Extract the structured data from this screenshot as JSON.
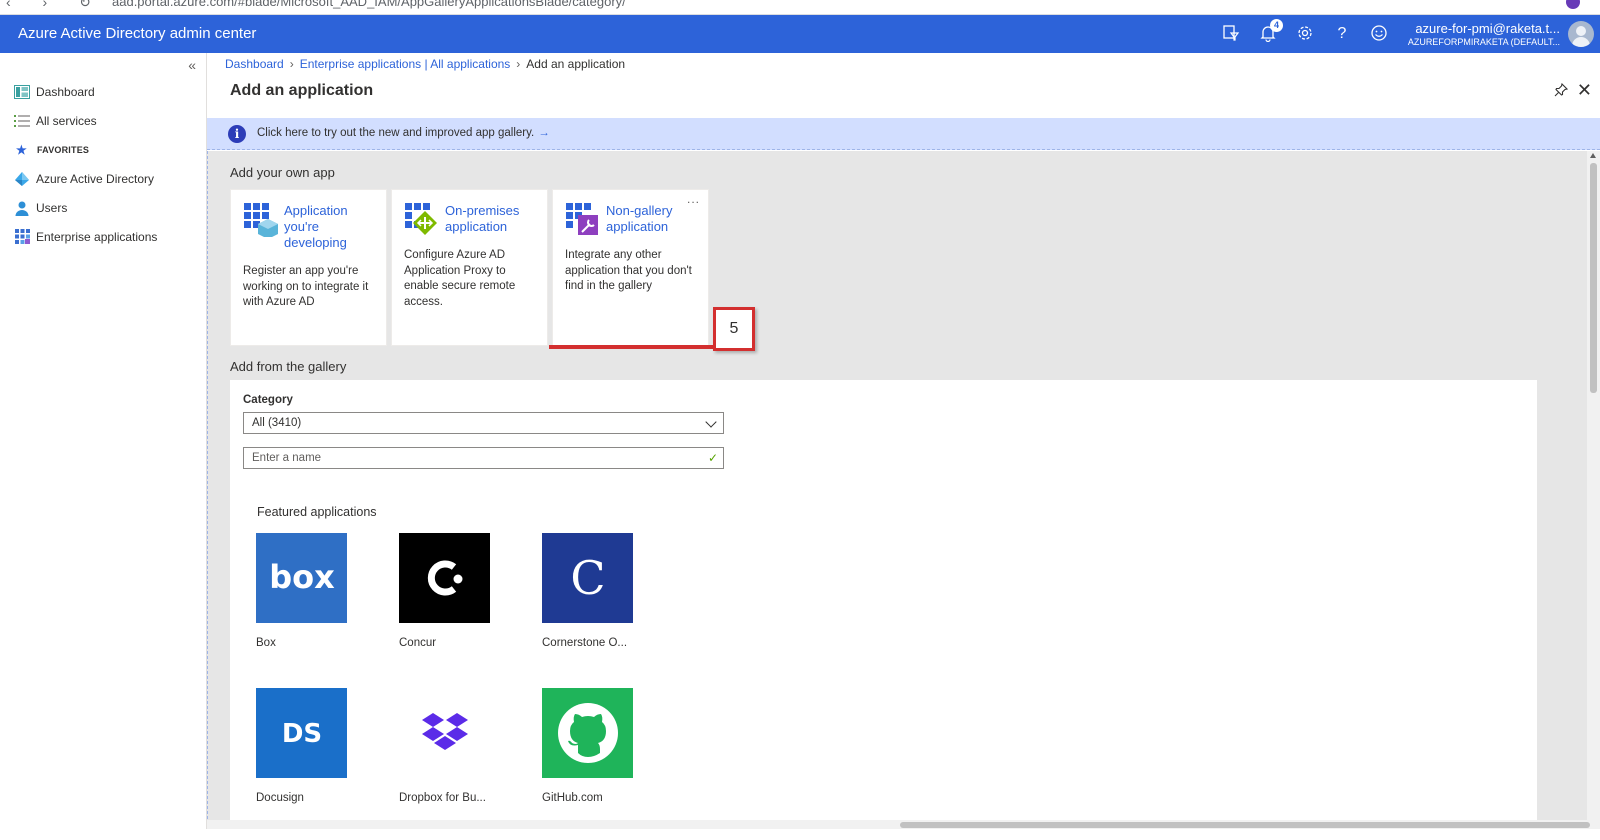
{
  "browser": {
    "url": "aad.portal.azure.com/#blade/Microsoft_AAD_IAM/AppGalleryApplicationsBlade/category/"
  },
  "topbar": {
    "title": "Azure Active Directory admin center",
    "notification_count": "4",
    "account_email": "azure-for-pmi@raketa.t...",
    "account_tenant": "AZUREFORPMIRAKETA (DEFAULT..."
  },
  "sidebar": {
    "collapse_icon": "«",
    "items": [
      {
        "label": "Dashboard",
        "icon": "dashboard-icon"
      },
      {
        "label": "All services",
        "icon": "list-icon"
      }
    ],
    "favorites_label": "FAVORITES",
    "favorites": [
      {
        "label": "Azure Active Directory",
        "icon": "aad-icon"
      },
      {
        "label": "Users",
        "icon": "user-icon"
      },
      {
        "label": "Enterprise applications",
        "icon": "apps-grid-icon"
      }
    ]
  },
  "breadcrumb": {
    "items": [
      "Dashboard",
      "Enterprise applications | All applications"
    ],
    "current": "Add an application"
  },
  "page": {
    "title": "Add an application"
  },
  "info": {
    "text": "Click here to try out the new and improved app gallery.",
    "arrow": "→"
  },
  "own_app": {
    "heading": "Add your own app",
    "cards": [
      {
        "title": "Application you're developing",
        "description": "Register an app you're working on to integrate it with Azure AD"
      },
      {
        "title": "On-premises application",
        "description": "Configure Azure AD Application Proxy to enable secure remote access."
      },
      {
        "title": "Non-gallery application",
        "description": "Integrate any other application that you don't find in the gallery"
      }
    ],
    "more_label": "...",
    "step_callout": "5"
  },
  "gallery": {
    "heading": "Add from the gallery",
    "category_label": "Category",
    "category_value": "All (3410)",
    "search_placeholder": "Enter a name",
    "featured_heading": "Featured applications",
    "apps": [
      {
        "name": "Box",
        "color": "#2f6fc5"
      },
      {
        "name": "Concur",
        "color": "#000000"
      },
      {
        "name": "Cornerstone O...",
        "color": "#1f3a93"
      },
      {
        "name": "Docusign",
        "color": "#1a6fc9"
      },
      {
        "name": "Dropbox for Bu...",
        "color": "#ffffff"
      },
      {
        "name": "GitHub.com",
        "color": "#1fb45a"
      }
    ]
  },
  "colors": {
    "topbar": "#2d63d9",
    "link": "#2d63d9",
    "highlight": "#d32f2f"
  }
}
